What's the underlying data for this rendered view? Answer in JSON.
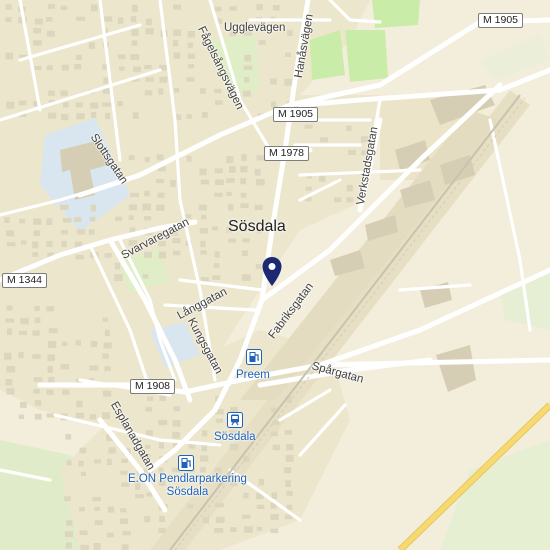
{
  "map": {
    "town": "Sösdala",
    "streets": {
      "ugglevagen": "Ugglevägen",
      "hanasvagen": "Hanåsvägen",
      "fagelsangsvagen": "Fågelsångsvägen",
      "slottsgatan": "Slottsgatan",
      "verkstadsgatan": "Verkstadsgatan",
      "svarvaregatan": "Svarvaregatan",
      "langgatan": "Långgatan",
      "kungsgatan": "Kungsgatan",
      "fabriksgatan": "Fabriksgatan",
      "spargatan": "Spårgatan",
      "esplanadgatan": "Esplanadgatan"
    },
    "shields": {
      "m1905_top": "M 1905",
      "m1905_mid": "M 1905",
      "m1978": "M 1978",
      "m1344": "M 1344",
      "m1908": "M 1908"
    },
    "pois": {
      "preem": "Preem",
      "station": "Sösdala",
      "eon_line1": "E.ON Pendlarparkering",
      "eon_line2": "Sösdala"
    },
    "icons": [
      "location-pin-icon",
      "fuel-station-icon",
      "train-station-icon",
      "ev-charging-icon"
    ],
    "colors": {
      "land": "#f3eedb",
      "residential": "#ece6cc",
      "building": "#ddd6bf",
      "park": "#dfeec6",
      "sports": "#c9eca8",
      "school": "#d9e6ef",
      "road": "#ffffff",
      "railway_band": "#e7dfc3",
      "highway": "#f7d972",
      "poi_blue": "#1f62b8",
      "pin": "#1d2a73"
    }
  }
}
